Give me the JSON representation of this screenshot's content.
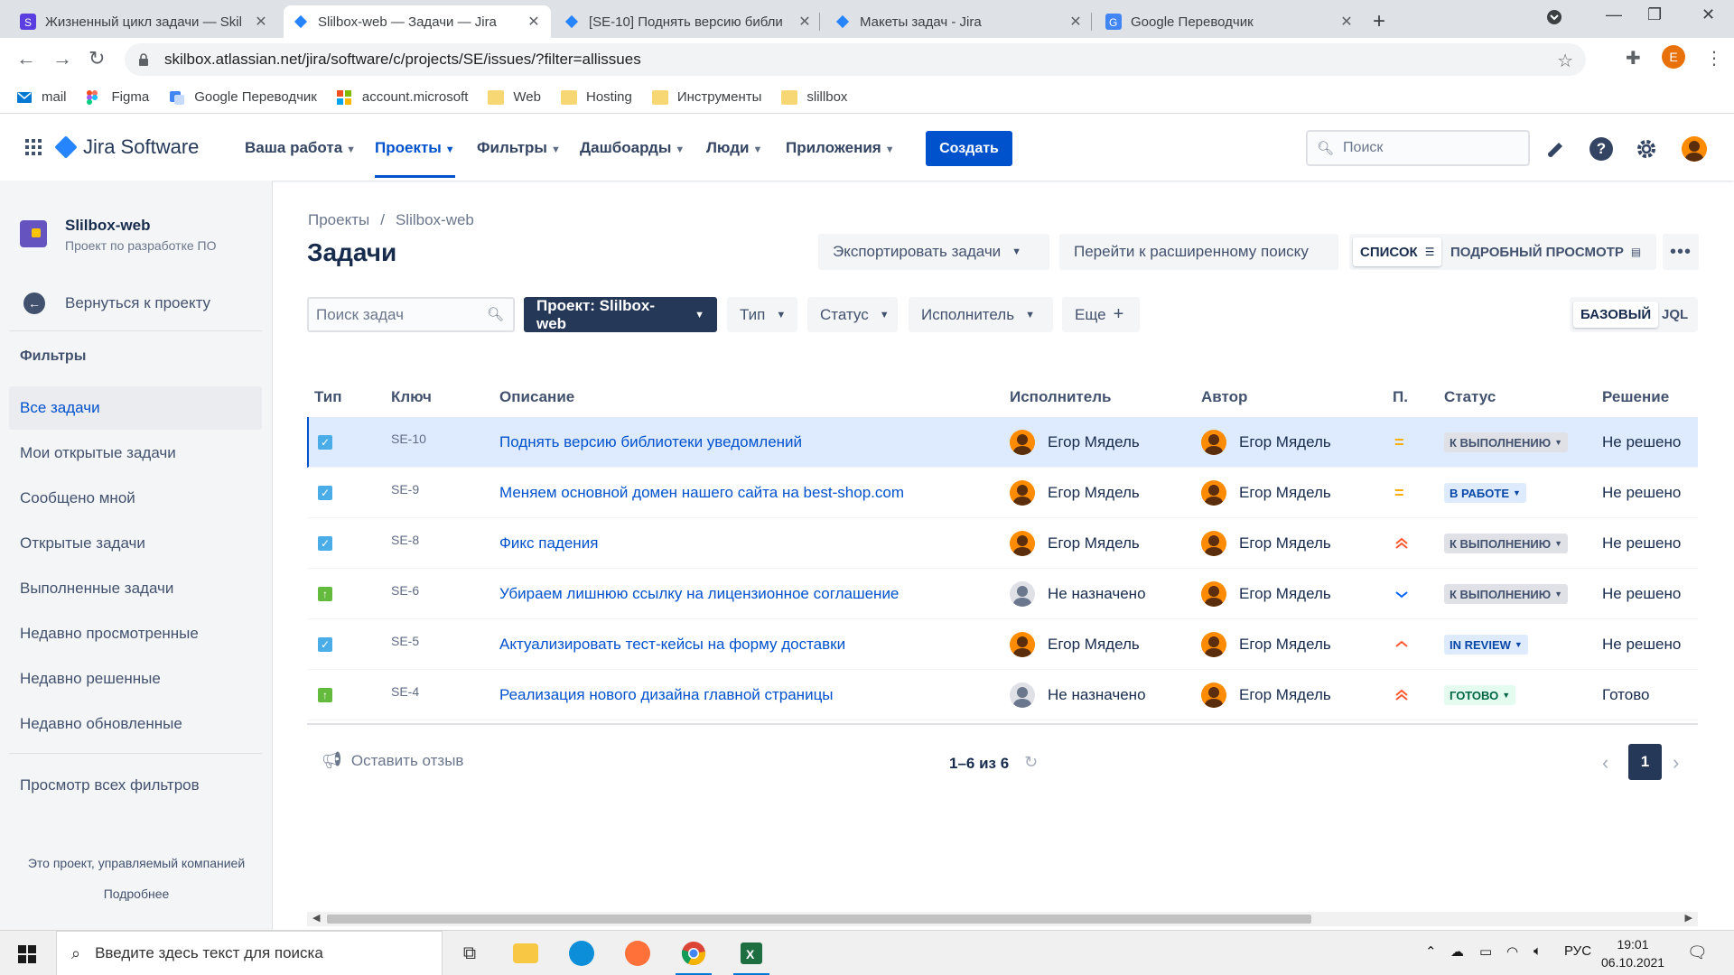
{
  "browser": {
    "tabs": [
      {
        "title": "Жизненный цикл задачи — Skil",
        "favicon": "skillbox-icon"
      },
      {
        "title": "Slilbox-web — Задачи — Jira",
        "favicon": "jira-icon"
      },
      {
        "title": "[SE-10] Поднять версию библи",
        "favicon": "jira-icon"
      },
      {
        "title": "Макеты задач - Jira",
        "favicon": "jira-icon"
      },
      {
        "title": "Google Переводчик",
        "favicon": "translate-icon"
      }
    ],
    "url": "skilbox.atlassian.net/jira/software/c/projects/SE/issues/?filter=allissues",
    "profile_initial": "E",
    "bookmarks": [
      {
        "label": "mail",
        "icon": "mail-icon"
      },
      {
        "label": "Figma",
        "icon": "figma-icon"
      },
      {
        "label": "Google Переводчик",
        "icon": "translate-icon"
      },
      {
        "label": "account.microsoft",
        "icon": "microsoft-icon"
      },
      {
        "label": "Web",
        "icon": "folder-icon"
      },
      {
        "label": "Hosting",
        "icon": "folder-icon"
      },
      {
        "label": "Инструменты",
        "icon": "folder-icon"
      },
      {
        "label": "slillbox",
        "icon": "folder-icon"
      }
    ]
  },
  "jira_nav": {
    "product": "Jira Software",
    "items": [
      "Ваша работа",
      "Проекты",
      "Фильтры",
      "Дашбоарды",
      "Люди",
      "Приложения"
    ],
    "active_item": "Проекты",
    "create": "Создать",
    "search_placeholder": "Поиск"
  },
  "sidebar": {
    "project_name": "Slilbox-web",
    "project_sub": "Проект по разработке ПО",
    "back": "Вернуться к проекту",
    "heading": "Фильтры",
    "items": [
      "Все задачи",
      "Мои открытые задачи",
      "Сообщено мной",
      "Открытые задачи",
      "Выполненные задачи",
      "Недавно просмотренные",
      "Недавно решенные",
      "Недавно обновленные"
    ],
    "view_all": "Просмотр всех фильтров",
    "footer_text": "Это проект, управляемый компанией",
    "footer_link": "Подробнее"
  },
  "main": {
    "breadcrumb": [
      "Проекты",
      "Slilbox-web"
    ],
    "title": "Задачи",
    "export": "Экспортировать задачи",
    "advanced": "Перейти к расширенному поиску",
    "view_list": "СПИСОК",
    "view_detail": "ПОДРОБНЫЙ ПРОСМОТР",
    "search_placeholder": "Поиск задач",
    "filters": {
      "project": "Проект: Slilbox-web",
      "type": "Тип",
      "status": "Статус",
      "assignee": "Исполнитель",
      "more": "Еще"
    },
    "mode_basic": "БАЗОВЫЙ",
    "mode_jql": "JQL",
    "columns": [
      "Тип",
      "Ключ",
      "Описание",
      "Исполнитель",
      "Автор",
      "П.",
      "Статус",
      "Решение"
    ],
    "rows": [
      {
        "type": "task",
        "key": "SE-10",
        "summary": "Поднять версию библиотеки уведомлений",
        "assignee": "Егор Мядель",
        "reporter": "Егор Мядель",
        "priority": "medium",
        "status": "К ВЫПОЛНЕНИЮ",
        "resolution": "Не решено"
      },
      {
        "type": "task",
        "key": "SE-9",
        "summary": "Меняем основной домен нашего сайта на best-shop.com",
        "assignee": "Егор Мядель",
        "reporter": "Егор Мядель",
        "priority": "medium",
        "status": "В РАБОТЕ",
        "resolution": "Не решено"
      },
      {
        "type": "task",
        "key": "SE-8",
        "summary": "Фикс падения",
        "assignee": "Егор Мядель",
        "reporter": "Егор Мядель",
        "priority": "highest",
        "status": "К ВЫПОЛНЕНИЮ",
        "resolution": "Не решено"
      },
      {
        "type": "story",
        "key": "SE-6",
        "summary": "Убираем лишнюю ссылку на лицензионное соглашение",
        "assignee": "Не назначено",
        "reporter": "Егор Мядель",
        "priority": "low",
        "status": "К ВЫПОЛНЕНИЮ",
        "resolution": "Не решено"
      },
      {
        "type": "task",
        "key": "SE-5",
        "summary": "Актуализировать тест-кейсы на форму доставки",
        "assignee": "Егор Мядель",
        "reporter": "Егор Мядель",
        "priority": "high",
        "status": "IN REVIEW",
        "resolution": "Не решено"
      },
      {
        "type": "story",
        "key": "SE-4",
        "summary": "Реализация нового дизайна главной страницы",
        "assignee": "Не назначено",
        "reporter": "Егор Мядель",
        "priority": "highest",
        "status": "ГОТОВО",
        "resolution": "Готово"
      }
    ],
    "feedback": "Оставить отзыв",
    "count": "1–6 из 6",
    "page": "1"
  },
  "taskbar": {
    "search_placeholder": "Введите здесь текст для поиска",
    "lang": "РУС",
    "time": "19:01",
    "date": "06.10.2021"
  },
  "colors": {
    "jira_blue": "#0052cc",
    "status_todo_bg": "#dfe1e6",
    "status_inprogress_bg": "#deebff",
    "status_done_bg": "#e3fcef",
    "priority_medium": "#ffab00",
    "priority_high": "#ff5630",
    "priority_low": "#0065ff"
  }
}
